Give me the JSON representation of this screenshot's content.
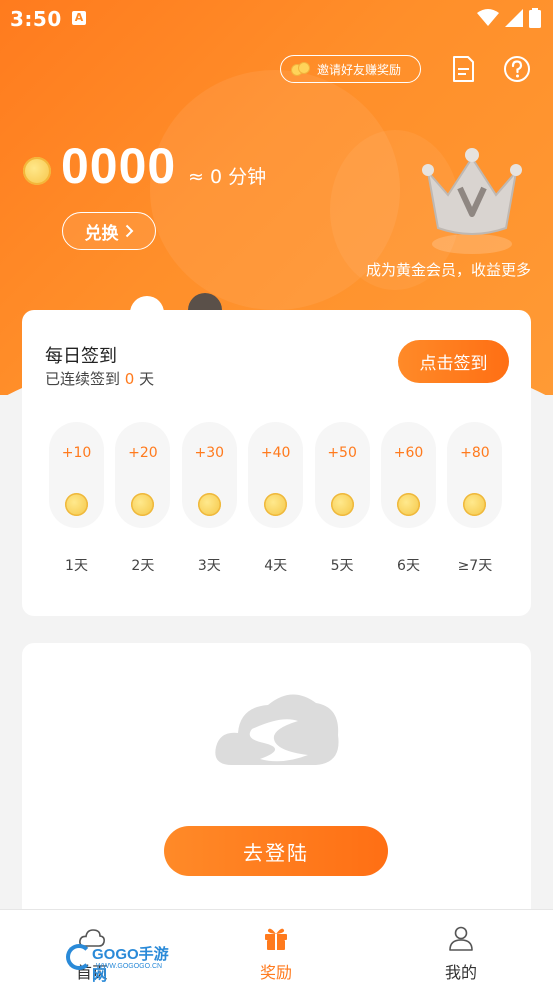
{
  "status_bar": {
    "time": "3:50",
    "app_indicator": "A"
  },
  "header": {
    "invite_label": "邀请好友赚奖励",
    "icons": [
      "document-icon",
      "help-icon"
    ]
  },
  "balance": {
    "coins": "0000",
    "approx": "≈ 0 分钟",
    "exchange_label": "兑换"
  },
  "vip": {
    "promo": "成为黄金会员，收益更多"
  },
  "sign_in": {
    "title": "每日签到",
    "subtitle_prefix": "已连续签到",
    "streak_days": "0",
    "subtitle_suffix": "天",
    "button_label": "点击签到",
    "days": [
      {
        "reward": "+10",
        "label": "1天"
      },
      {
        "reward": "+20",
        "label": "2天"
      },
      {
        "reward": "+30",
        "label": "3天"
      },
      {
        "reward": "+40",
        "label": "4天"
      },
      {
        "reward": "+50",
        "label": "5天"
      },
      {
        "reward": "+60",
        "label": "6天"
      },
      {
        "reward": "+80",
        "label": "≥7天"
      }
    ]
  },
  "login": {
    "button_label": "去登陆"
  },
  "tabbar": {
    "tabs": [
      {
        "label": "首页",
        "icon": "cloud-icon",
        "active": false
      },
      {
        "label": "奖励",
        "icon": "gift-icon",
        "active": true
      },
      {
        "label": "我的",
        "icon": "user-icon",
        "active": false
      }
    ]
  },
  "watermark": {
    "text": "GOGO手游网",
    "sub": "WWW.GOGOGO.CN"
  },
  "colors": {
    "accent": "#ff7a1d",
    "hero": "#ff8a26"
  }
}
